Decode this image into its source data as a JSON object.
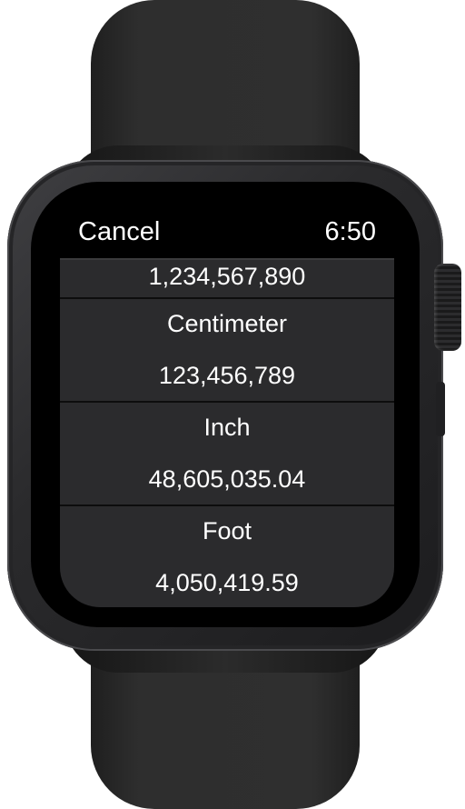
{
  "status_bar": {
    "cancel_label": "Cancel",
    "time": "6:50"
  },
  "rows": [
    {
      "unit": "",
      "value": "1,234,567,890"
    },
    {
      "unit": "Centimeter",
      "value": "123,456,789"
    },
    {
      "unit": "Inch",
      "value": "48,605,035.04"
    },
    {
      "unit": "Foot",
      "value": "4,050,419.59"
    }
  ]
}
